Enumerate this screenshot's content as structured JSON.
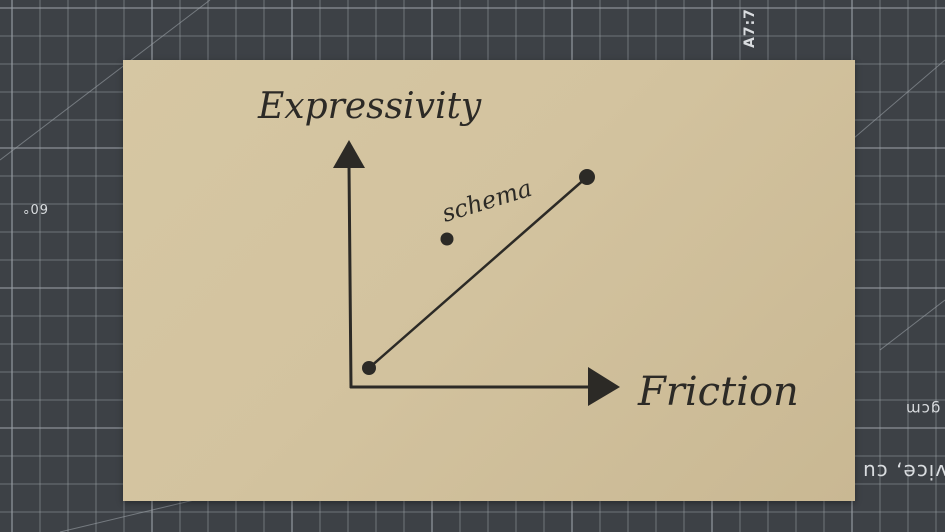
{
  "cutting_mat": {
    "labels": {
      "top_right": "A7:7",
      "left": "60°",
      "right_mid": "gcm",
      "right_bottom": "vice, cu"
    },
    "colors": {
      "mat": "#3d4146",
      "grid": "#9aa0a6"
    }
  },
  "sketch": {
    "y_axis_label": "Expressivity",
    "x_axis_label": "Friction",
    "point_label": "schema",
    "ink_color": "#2c2a26",
    "paper_color": "#d6c7a3"
  }
}
